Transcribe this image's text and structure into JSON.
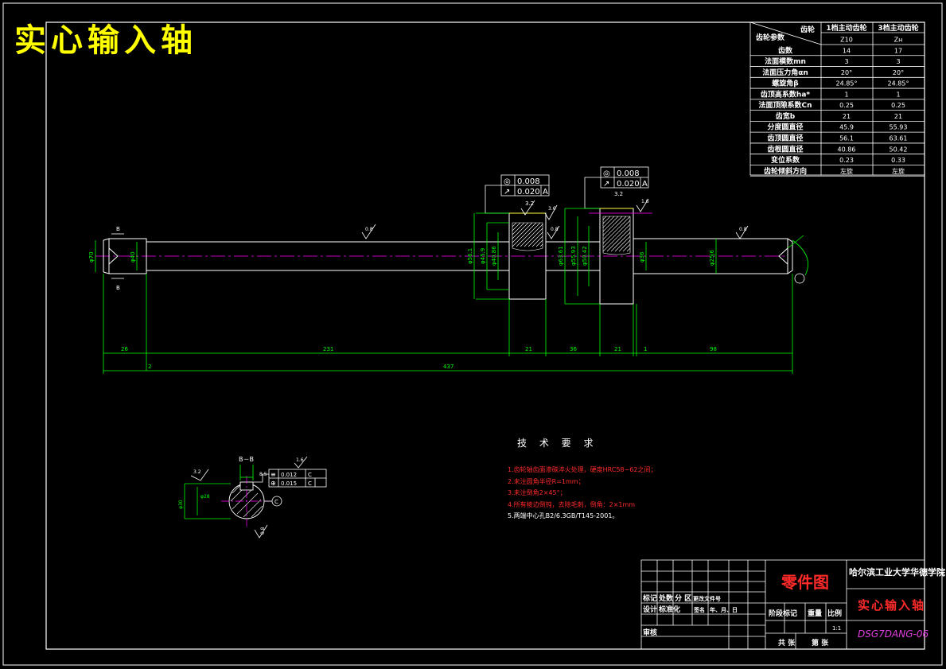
{
  "title": "实心输入轴",
  "gear_table": {
    "header_gear": "齿轮",
    "header_param": "齿轮参数",
    "col1": "1档主动齿轮",
    "col2": "3档主动齿轮",
    "rows": [
      {
        "label": "",
        "v1": "Z10",
        "v2": "Zн"
      },
      {
        "label": "齿数",
        "v1": "14",
        "v2": "17"
      },
      {
        "label": "法面模数mn",
        "v1": "3",
        "v2": "3"
      },
      {
        "label": "法面压力角αn",
        "v1": "20°",
        "v2": "20°"
      },
      {
        "label": "螺旋角β",
        "v1": "24.85°",
        "v2": "24.85°"
      },
      {
        "label": "齿顶高系数ha*",
        "v1": "1",
        "v2": "1"
      },
      {
        "label": "法面顶隙系数Cn",
        "v1": "0.25",
        "v2": "0.25"
      },
      {
        "label": "齿宽b",
        "v1": "21",
        "v2": "21"
      },
      {
        "label": "分度圆直径",
        "v1": "45.9",
        "v2": "55.93"
      },
      {
        "label": "齿顶圆直径",
        "v1": "56.1",
        "v2": "63.61"
      },
      {
        "label": "齿根圆直径",
        "v1": "40.86",
        "v2": "50.42"
      },
      {
        "label": "变位系数",
        "v1": "0.23",
        "v2": "0.33"
      },
      {
        "label": "齿轮倾斜方向",
        "v1": "左旋",
        "v2": "左旋"
      }
    ]
  },
  "tolerance_1": {
    "runout_sym": "◎",
    "runout": "0.008",
    "circ_sym": "↗",
    "circ": "0.020",
    "datum": "A",
    "rough": "3.2"
  },
  "tolerance_2": {
    "runout_sym": "◎",
    "runout": "0.008",
    "circ_sym": "↗",
    "circ": "0.020",
    "datum": "A",
    "rough": "3.2"
  },
  "roughness": {
    "r1": "0.8",
    "r2": "3.6",
    "r3": "0.8",
    "r4": "1.6",
    "r5": "0.8",
    "r6": "0.8"
  },
  "section_labels": {
    "b1": "B",
    "b2": "B"
  },
  "diameters": {
    "d_left1": "φ70",
    "d_left2": "φ40",
    "g1a": "φ56.1",
    "g1b": "φ45.9",
    "g1c": "φ40.86",
    "g2a": "φ63.61",
    "g2b": "φ55.93",
    "g2c": "φ50.42",
    "d_mid": "φ36",
    "d_right": "φ25j6"
  },
  "dims": {
    "d26": "26",
    "d231": "231",
    "d21a": "21",
    "d36": "36",
    "d21b": "21",
    "d1": "1",
    "d98": "98",
    "d2": "2",
    "d437": "437"
  },
  "section_bb": {
    "title": "B－B",
    "rough": "3.2",
    "key": "8.5",
    "tol1_sym": "≡",
    "tol1": "0.012",
    "tol1_datum": "C",
    "tol2_sym": "⊕",
    "tol2": "0.015",
    "tol2_datum": "C",
    "datum": "C",
    "d1": "φ30",
    "d2": "φ28",
    "rough2": "0.8",
    "rough_top": "1.6"
  },
  "tech_req": {
    "title": "技 术 要 求",
    "items": [
      "1.齿轮轴齿面渗碳淬火处理，硬度HRC58~62之间；",
      "2.未注圆角半径R=1mm；",
      "3.未注倒角2×45°；",
      "4.所有棱边倒钝，去除毛刺，倒角：2×1mm",
      "5.两端中心孔B2/6.3GB/T145-2001。"
    ]
  },
  "titleblock": {
    "part_drawing": "零件图",
    "school": "哈尔滨工业大学华德学院",
    "part_name": "实心输入轴",
    "code": "DSG7DANG-06",
    "l_mark": "标记",
    "l_count": "处数",
    "l_zone": "分 区",
    "l_change": "更改文件号",
    "l_sign": "签名",
    "l_date": "年、月、日",
    "l_design": "设计",
    "l_std": "标准化",
    "l_stage": "阶段标记",
    "l_weight": "重量",
    "l_scale": "比例",
    "l_check": "审核",
    "l_process": "工艺",
    "l_approve": "批准",
    "scale": "1:1",
    "l_total": "共 张",
    "l_sheet": "第 张"
  }
}
